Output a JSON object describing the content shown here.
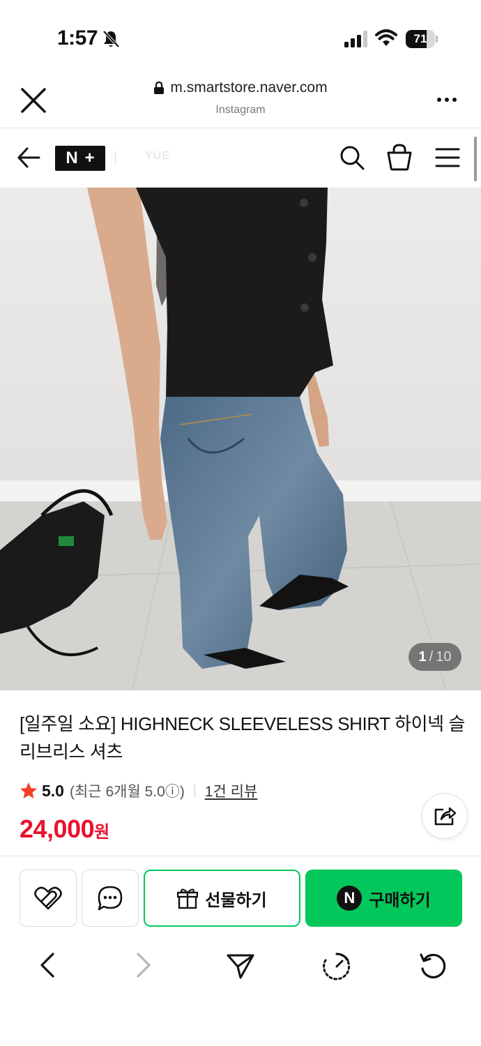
{
  "status_bar": {
    "time": "1:57",
    "battery": "71",
    "battery_level": 0.71,
    "icons": [
      "bell-slash-icon",
      "cellular-signal-icon",
      "wifi-icon",
      "battery-icon"
    ]
  },
  "browser_header": {
    "url": "m.smartstore.naver.com",
    "source": "Instagram",
    "icons": [
      "close-icon",
      "lock-icon",
      "more-dots-icon"
    ]
  },
  "store_nav": {
    "logo_letters": [
      "N",
      "+"
    ],
    "store_name": "YUE",
    "icons": [
      "back-arrow-icon",
      "search-icon",
      "shopping-bag-icon",
      "menu-icon"
    ]
  },
  "product": {
    "image_counter": {
      "current": "1",
      "separator": "/",
      "total": "10"
    },
    "title": "[일주일 소요] HIGHNECK SLEEVELESS SHIRT 하이넥 슬리브리스 셔츠",
    "rating": "5.0",
    "recent_rating": "(최근 6개월 5.0",
    "info_glyph": "ⓘ",
    "recent_close": ")",
    "reviews": "1건 리뷰",
    "price": "24,000",
    "currency": "원"
  },
  "actions": {
    "gift_label": "선물하기",
    "buy_badge": "N",
    "buy_label": "구매하기",
    "accent": "#03c75a",
    "price_color": "#e8112d"
  },
  "toolbar": {
    "icons": [
      "back-icon",
      "forward-icon",
      "send-icon",
      "timer-icon",
      "reload-icon"
    ]
  }
}
